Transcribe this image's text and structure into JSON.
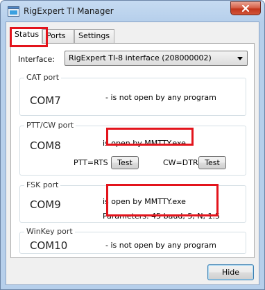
{
  "window": {
    "title": "RigExpert TI Manager",
    "close_label": "x"
  },
  "tabs": [
    {
      "label": "Status",
      "active": true
    },
    {
      "label": "Ports",
      "active": false
    },
    {
      "label": "Settings",
      "active": false
    }
  ],
  "interface": {
    "label": "Interface:",
    "selected": "RigExpert TI-8 interface (208000002)"
  },
  "cat_port": {
    "title": "CAT port",
    "port": "COM7",
    "status": "- is not open by any program"
  },
  "ptt_port": {
    "title": "PTT/CW port",
    "port": "COM8",
    "status": "is open by MMTTY.exe",
    "ptt_label": "PTT=RTS",
    "ptt_test_label": "Test",
    "cw_label": "CW=DTR",
    "cw_test_label": "Test"
  },
  "fsk_port": {
    "title": "FSK port",
    "port": "COM9",
    "status": "is open by MMTTY.exe",
    "parameters": "Parameters: 45 baud, 5, N, 1.5"
  },
  "winkey_port": {
    "title": "WinKey port",
    "port": "COM10",
    "status": "- is not open by any program"
  },
  "footer": {
    "hide_label": "Hide"
  },
  "colors": {
    "highlight": "#e3141c",
    "close_button": "#c2361c",
    "title_bar": "#b6cfeb"
  }
}
